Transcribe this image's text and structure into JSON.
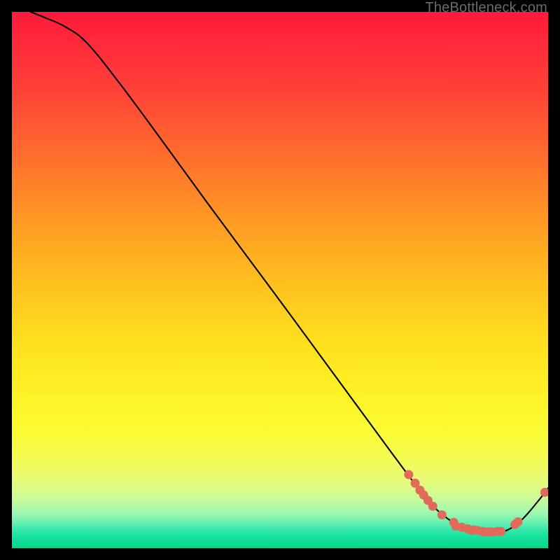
{
  "watermark": "TheBottleneck.com",
  "chart_data": {
    "type": "line",
    "title": "",
    "xlabel": "",
    "ylabel": "",
    "xlim": [
      0,
      100
    ],
    "ylim": [
      0,
      100
    ],
    "series": [
      {
        "name": "curve",
        "color": "#000000",
        "x": [
          3.5,
          6,
          10,
          14,
          20,
          28,
          36,
          44,
          52,
          60,
          68,
          74,
          78,
          82,
          86,
          89,
          92,
          95,
          98,
          100
        ],
        "y": [
          100,
          99,
          97.2,
          94.2,
          86.8,
          76.0,
          65.0,
          54.2,
          43.4,
          32.5,
          21.6,
          13.5,
          8.4,
          5.0,
          3.4,
          3.0,
          3.2,
          5.2,
          8.6,
          11.2
        ]
      }
    ],
    "markers": [
      {
        "name": "dots",
        "color": "#e26a5a",
        "radius_px": 6.5,
        "points": [
          {
            "x": 74.0,
            "y": 13.7
          },
          {
            "x": 75.2,
            "y": 12.1
          },
          {
            "x": 76.1,
            "y": 10.8
          },
          {
            "x": 76.8,
            "y": 9.9
          },
          {
            "x": 77.6,
            "y": 8.9
          },
          {
            "x": 78.5,
            "y": 7.8
          },
          {
            "x": 80.2,
            "y": 6.2
          },
          {
            "x": 82.4,
            "y": 4.8
          },
          {
            "x": 82.8,
            "y": 4.1
          },
          {
            "x": 83.9,
            "y": 3.9
          },
          {
            "x": 85.0,
            "y": 3.6
          },
          {
            "x": 85.7,
            "y": 3.3
          },
          {
            "x": 86.1,
            "y": 3.4
          },
          {
            "x": 86.8,
            "y": 3.3
          },
          {
            "x": 87.7,
            "y": 3.1
          },
          {
            "x": 88.2,
            "y": 3.0
          },
          {
            "x": 89.0,
            "y": 3.0
          },
          {
            "x": 89.6,
            "y": 3.0
          },
          {
            "x": 90.6,
            "y": 3.1
          },
          {
            "x": 91.2,
            "y": 3.1
          },
          {
            "x": 93.8,
            "y": 4.4
          },
          {
            "x": 94.4,
            "y": 4.9
          },
          {
            "x": 99.4,
            "y": 10.4
          }
        ]
      }
    ]
  }
}
